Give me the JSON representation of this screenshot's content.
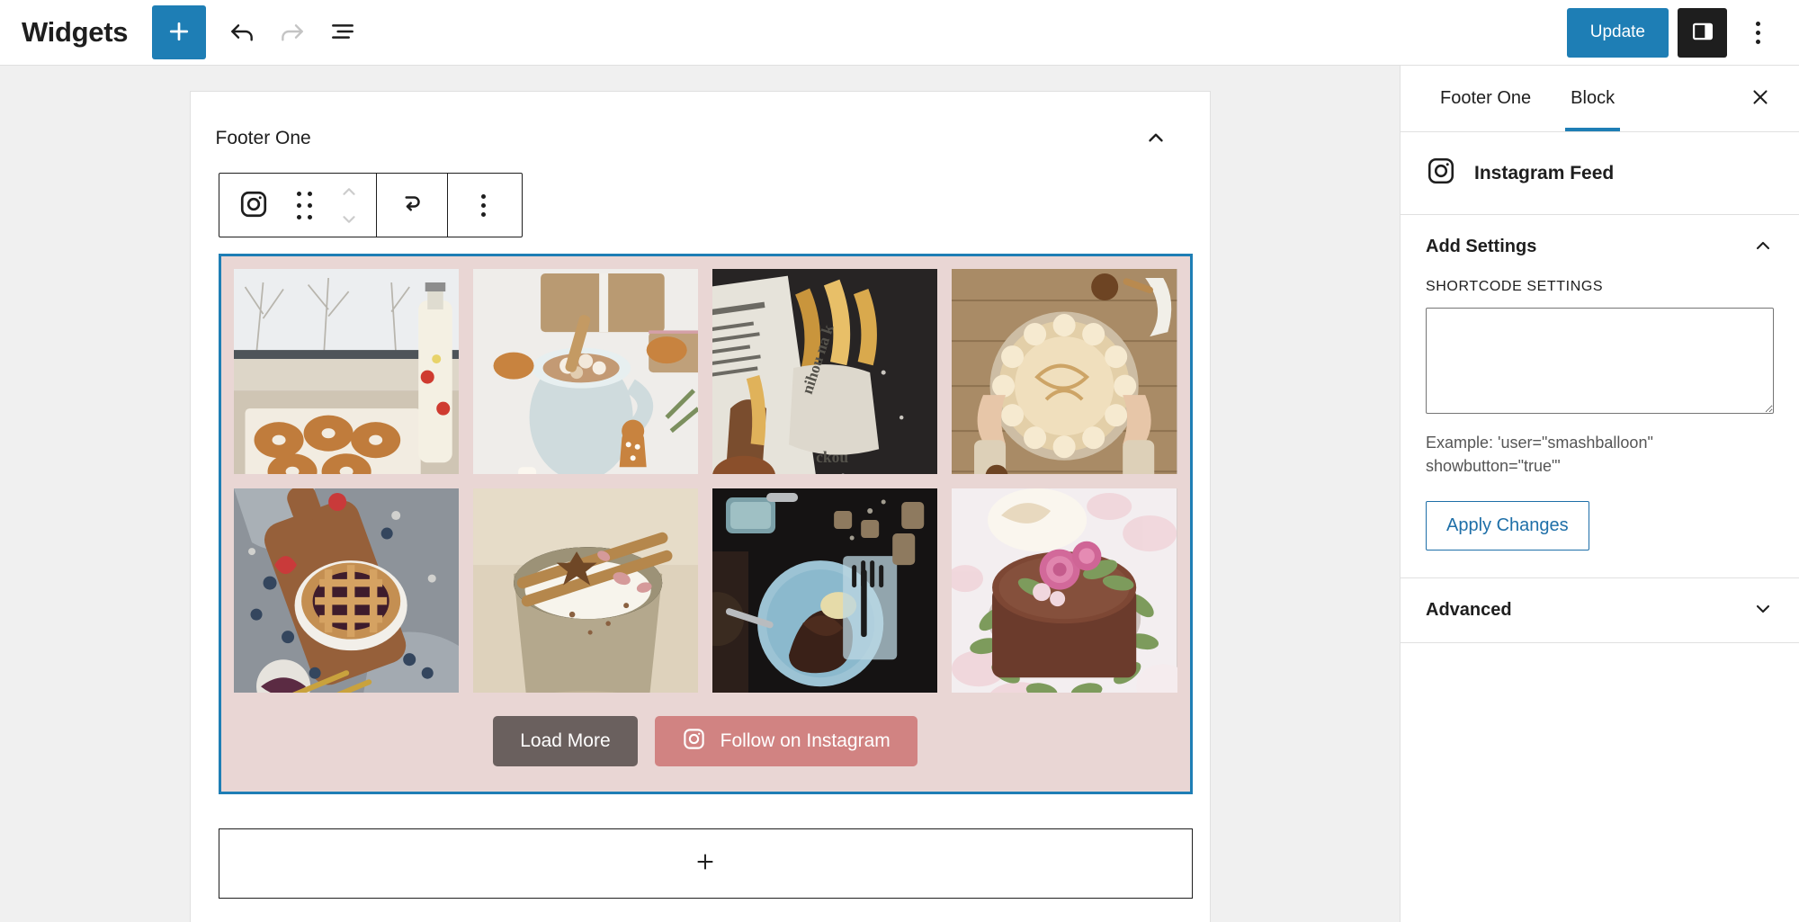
{
  "header": {
    "title": "Widgets",
    "add_block_label": "Add block",
    "undo_label": "Undo",
    "redo_label": "Redo",
    "list_view_label": "List view",
    "update_label": "Update",
    "settings_toggle_label": "Settings",
    "options_label": "Options"
  },
  "canvas": {
    "widget_area_title": "Footer One",
    "collapse_label": "Collapse",
    "block_toolbar": {
      "block_icon_label": "Instagram Feed",
      "drag_label": "Drag",
      "move_up_label": "Move up",
      "move_down_label": "Move down",
      "transform_label": "Transform",
      "more_label": "Options"
    },
    "feed": {
      "items": [
        {
          "alt": "Powdered donuts on tray with milk bottle by snowy window"
        },
        {
          "alt": "Hot cocoa with marshmallows, gingerbread men and wrapped gifts"
        },
        {
          "alt": "Churros wrapped in newspaper with chocolate dipping sauce"
        },
        {
          "alt": "Hands holding a meringue-topped pie on rustic wood table"
        },
        {
          "alt": "Berry lattice pie on wooden board with blueberries and forks"
        },
        {
          "alt": "Latte in ceramic cup with cinnamon sticks and star anise"
        },
        {
          "alt": "Slice of chocolate cake on blue plate with fork, dark table"
        },
        {
          "alt": "Chocolate cake decorated with pink roses and greenery"
        }
      ],
      "load_more_label": "Load More",
      "follow_label": "Follow on Instagram"
    },
    "appender_label": "Add block"
  },
  "sidebar": {
    "tabs": [
      {
        "label": "Footer One",
        "active": false
      },
      {
        "label": "Block",
        "active": true
      }
    ],
    "close_label": "Close settings",
    "block_name": "Instagram Feed",
    "panels": [
      {
        "title": "Add Settings",
        "expanded": true,
        "field_label": "SHORTCODE SETTINGS",
        "field_value": "",
        "field_placeholder": "",
        "help_text": "Example: 'user=\"smashballoon\" showbutton=\"true\"'",
        "apply_label": "Apply Changes"
      },
      {
        "title": "Advanced",
        "expanded": false
      }
    ]
  },
  "colors": {
    "accent_blue": "#1e7eb5",
    "feed_background": "#e9d6d4",
    "load_more_button": "#6a605e",
    "follow_button": "#d18382",
    "canvas_background": "#f0f0f0"
  }
}
